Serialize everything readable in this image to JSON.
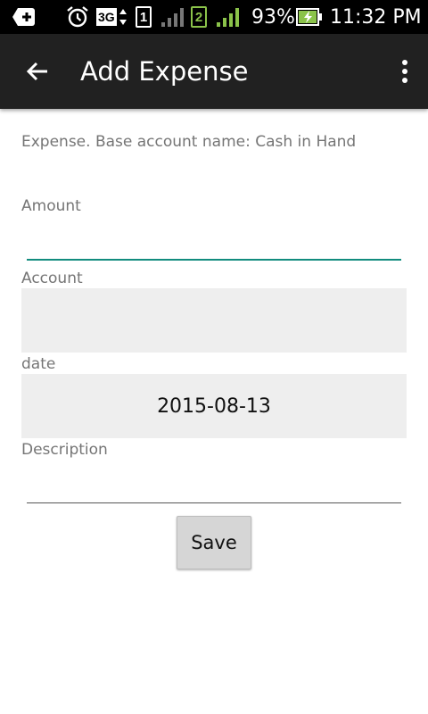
{
  "status_bar": {
    "time": "11:32 PM",
    "battery_percent": "93%",
    "network_type": "3G",
    "sim1_label": "1",
    "sim2_label": "2",
    "sim2_color": "#8bc34a"
  },
  "app_bar": {
    "title": "Add Expense",
    "background": "#212121"
  },
  "form": {
    "subtitle": "Expense. Base account name: Cash in Hand",
    "amount_label": "Amount",
    "amount_value": "",
    "account_label": "Account",
    "account_value": "",
    "date_label": "date",
    "date_value": "2015-08-13",
    "description_label": "Description",
    "description_value": "",
    "save_label": "Save",
    "accent_color": "#128c7e"
  }
}
